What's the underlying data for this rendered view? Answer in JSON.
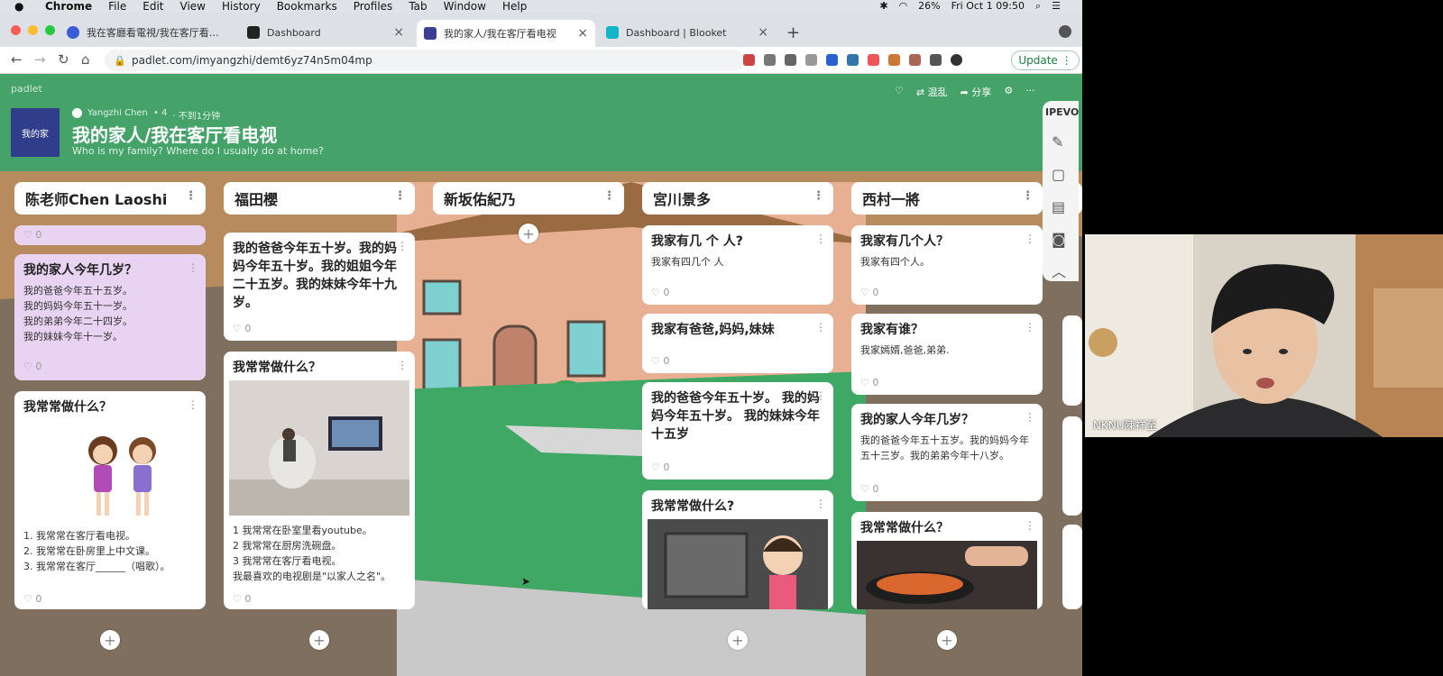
{
  "menubar": {
    "apple": "",
    "app": "Chrome",
    "items": [
      "File",
      "Edit",
      "View",
      "History",
      "Bookmarks",
      "Profiles",
      "Tab",
      "Window",
      "Help"
    ],
    "battery": "26%",
    "clock": "Fri Oct 1  09:50"
  },
  "tabs": [
    {
      "label": "我在客廳看電視/我在客厅看电视",
      "favicon_color": "#3c5bd6"
    },
    {
      "label": "Dashboard",
      "favicon_color": "#222222"
    },
    {
      "label": "我的家人/我在客厅看电视",
      "favicon_color": "#3a3f8f"
    },
    {
      "label": "Dashboard | Blooket",
      "favicon_color": "#15b5c9"
    }
  ],
  "toolbar": {
    "url": "padlet.com/imyangzhi/demt6yz74n5m04mp",
    "update_label": "Update"
  },
  "board": {
    "brand": "padlet",
    "author": "Yangzhi Chen",
    "contributors": "• 4",
    "time": "· 不到1分钟",
    "title": "我的家人/我在客厅看电视",
    "subtitle": "Who is my family? Where do I usually do at home?",
    "logo_text": "我的家",
    "header_actions": [
      "♡",
      "⇄ 混乱",
      "➦ 分享",
      "⚙",
      "···"
    ]
  },
  "columns": [
    {
      "title": "陈老师Chen Laoshi"
    },
    {
      "title": "福田櫻"
    },
    {
      "title": "新坂佑紀乃"
    },
    {
      "title": "宮川景多"
    },
    {
      "title": "西村一將"
    }
  ],
  "cards": {
    "c1a_like": "♡ 0",
    "c1b": {
      "title": "我的家人今年几岁？",
      "body": "我的爸爸今年五十五岁。\n我的妈妈今年五十一岁。\n我的弟弟今年二十四岁。\n我的妹妹今年十一岁。",
      "like": "♡ 0"
    },
    "c1c": {
      "title": "我常常做什么？",
      "body": "1. 我常常在客厅看电视。\n2. 我常常在卧房里上中文课。\n3. 我常常在客厅______（唱歌）。",
      "like": "♡ 0"
    },
    "c2a": {
      "title": "我的爸爸今年五十岁。我的妈妈今年五十岁。我的姐姐今年二十五岁。我的妹妹今年十九岁。",
      "like": "♡ 0"
    },
    "c2b": {
      "title": "我常常做什么？",
      "body": "1 我常常在卧室里看youtube。\n2 我常常在厨房洗碗盘。\n3 我常常在客厅看电视。\n我最喜欢的电视剧是\"以家人之名\"。",
      "like": "♡ 0"
    },
    "c4a": {
      "title": "我家有几 个 人?",
      "body": "我家有四几个 人",
      "like": "♡ 0"
    },
    "c4b": {
      "title": "我家有爸爸,妈妈,妹妹",
      "like": "♡ 0"
    },
    "c4c": {
      "title": "我的爸爸今年五十岁。   我的妈妈今年五十岁。    我的妹妹今年十五岁",
      "like": "♡ 0"
    },
    "c4d": {
      "title": "我常常做什么?"
    },
    "c5a": {
      "title": "我家有几个人？",
      "body": "我家有四个人。",
      "like": "♡ 0"
    },
    "c5b": {
      "title": "我家有谁？",
      "body": "我家嫣婿,爸爸,弟弟.",
      "like": "♡ 0"
    },
    "c5c": {
      "title": "我的家人今年几岁？",
      "body": "我的爸爸今年五十五岁。我的妈妈今年五十三岁。我的弟弟今年十八岁。",
      "like": "♡ 0"
    },
    "c5d": {
      "title": "我常常做什么？"
    }
  },
  "ipevo": {
    "label": "IPEVO"
  },
  "video": {
    "name": "NKNU陳祥至"
  }
}
